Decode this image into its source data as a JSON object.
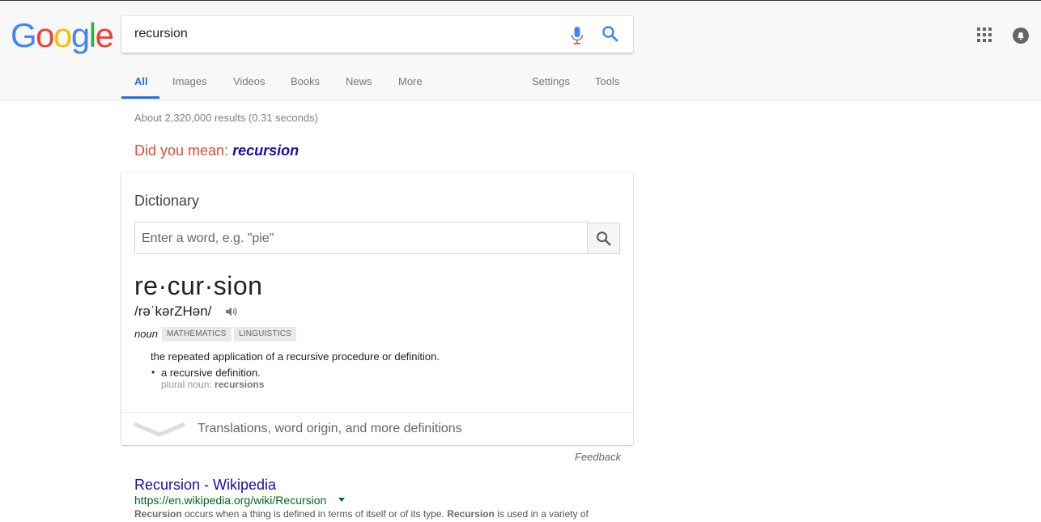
{
  "search": {
    "query": "recursion"
  },
  "tabs": [
    {
      "label": "All"
    },
    {
      "label": "Images"
    },
    {
      "label": "Videos"
    },
    {
      "label": "Books"
    },
    {
      "label": "News"
    },
    {
      "label": "More"
    },
    {
      "label": "Settings"
    },
    {
      "label": "Tools"
    }
  ],
  "stats": "About 2,320,000 results (0.31 seconds)",
  "did_you_mean": {
    "prefix": "Did you mean: ",
    "suggestion": "recursion"
  },
  "dictionary": {
    "title": "Dictionary",
    "input_placeholder": "Enter a word, e.g. \"pie\"",
    "word": "re·cur·sion",
    "phonetic": "/rəˈkərZHən/",
    "part_of_speech": "noun",
    "labels": [
      "MATHEMATICS",
      "LINGUISTICS"
    ],
    "definition": "the repeated application of a recursive procedure or definition.",
    "example": "a recursive definition.",
    "plural_label": "plural noun: ",
    "plural_value": "recursions",
    "more_link": "Translations, word origin, and more definitions"
  },
  "feedback": "Feedback",
  "result": {
    "title": "Recursion - Wikipedia",
    "url": "https://en.wikipedia.org/wiki/Recursion",
    "snippet_bold_1": "Recursion",
    "snippet_text_1": " occurs when a thing is defined in terms of itself or of its type. ",
    "snippet_bold_2": "Recursion",
    "snippet_text_2": " is used in a variety of"
  },
  "colors": {
    "accent": "#1a73e8",
    "link": "#1a0dab",
    "url_green": "#006621",
    "did_you_mean_red": "#dd4b39"
  },
  "icons": [
    "google-logo",
    "mic-icon",
    "search-icon",
    "apps-grid-icon",
    "notifications-icon",
    "speaker-icon",
    "chevron-down-icon"
  ]
}
